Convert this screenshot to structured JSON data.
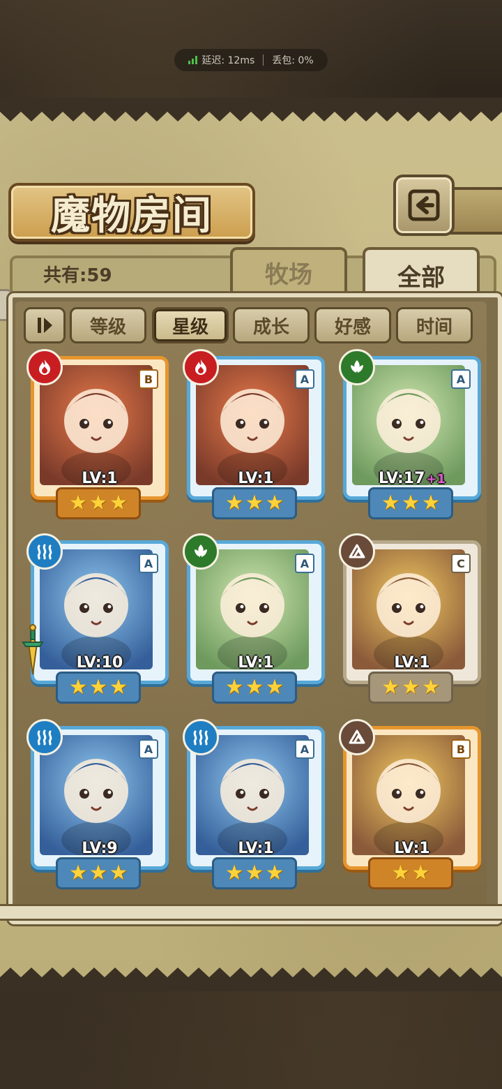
{
  "status": {
    "latency_label": "延迟: 12ms",
    "packet_loss_label": "丢包: 0%"
  },
  "header": {
    "title": "魔物房间",
    "back_icon": "return-arrow-icon"
  },
  "tabs": {
    "count_label": "共有:59",
    "pasture": "牧场",
    "all": "全部"
  },
  "sort": {
    "toggle_icon": "sort-order-icon",
    "options": [
      "等级",
      "星级",
      "成长",
      "好感",
      "时间"
    ],
    "active": "星级"
  },
  "colors": {
    "fire": "#c81e22",
    "leaf": "#2d7a2b",
    "water": "#1f7ec2",
    "earth": "#6a4a38",
    "frame_blue": "#58a8d8",
    "frame_orange": "#e6962e",
    "frame_gray": "#b7a98c",
    "star": "#ffd23a"
  },
  "monsters": [
    {
      "element": "fire",
      "grade": "B",
      "level": "LV:1",
      "bonus": "",
      "stars": 3,
      "frame": "orange"
    },
    {
      "element": "fire",
      "grade": "A",
      "level": "LV:1",
      "bonus": "",
      "stars": 3,
      "frame": "blue"
    },
    {
      "element": "leaf",
      "grade": "A",
      "level": "LV:17",
      "bonus": "+1",
      "stars": 3,
      "frame": "blue"
    },
    {
      "element": "water",
      "grade": "A",
      "level": "LV:10",
      "bonus": "",
      "stars": 3,
      "frame": "blue",
      "equip": "sword-icon"
    },
    {
      "element": "leaf",
      "grade": "A",
      "level": "LV:1",
      "bonus": "",
      "stars": 3,
      "frame": "blue"
    },
    {
      "element": "earth",
      "grade": "C",
      "level": "LV:1",
      "bonus": "",
      "stars": 3,
      "frame": "gray"
    },
    {
      "element": "water",
      "grade": "A",
      "level": "LV:9",
      "bonus": "",
      "stars": 3,
      "frame": "blue"
    },
    {
      "element": "water",
      "grade": "A",
      "level": "LV:1",
      "bonus": "",
      "stars": 3,
      "frame": "blue"
    },
    {
      "element": "earth",
      "grade": "B",
      "level": "LV:1",
      "bonus": "",
      "stars": 2,
      "frame": "orange"
    }
  ]
}
